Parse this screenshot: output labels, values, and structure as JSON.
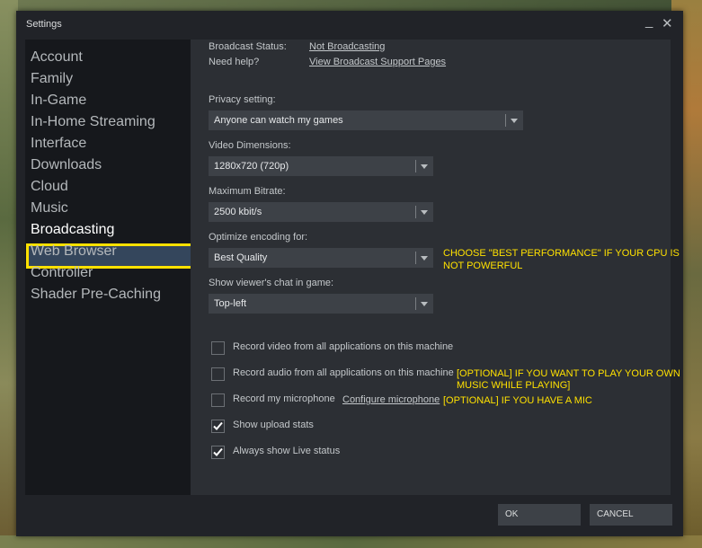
{
  "window": {
    "title": "Settings",
    "minimize_glyph": "_",
    "close_glyph": "✕"
  },
  "sidebar": {
    "items": [
      {
        "label": "Account"
      },
      {
        "label": "Family"
      },
      {
        "label": "In-Game"
      },
      {
        "label": "In-Home Streaming"
      },
      {
        "label": "Interface"
      },
      {
        "label": "Downloads"
      },
      {
        "label": "Cloud"
      },
      {
        "label": "Music"
      },
      {
        "label": "Broadcasting",
        "active": true
      },
      {
        "label": "Web Browser"
      },
      {
        "label": "Controller"
      },
      {
        "label": "Shader Pre-Caching"
      }
    ]
  },
  "broadcast": {
    "status_label": "Broadcast Status:",
    "status_value": "Not Broadcasting",
    "help_label": "Need help?",
    "help_link": "View Broadcast Support Pages",
    "privacy_label": "Privacy setting:",
    "privacy_value": "Anyone can watch my games",
    "dimensions_label": "Video Dimensions:",
    "dimensions_value": "1280x720 (720p)",
    "bitrate_label": "Maximum Bitrate:",
    "bitrate_value": "2500 kbit/s",
    "encoding_label": "Optimize encoding for:",
    "encoding_value": "Best Quality",
    "chat_label": "Show viewer's chat in game:",
    "chat_value": "Top-left",
    "record_video": {
      "label": "Record video from all applications on this machine",
      "checked": false
    },
    "record_audio": {
      "label": "Record audio from all applications on this machine",
      "checked": false
    },
    "record_mic": {
      "label": "Record my microphone",
      "checked": false,
      "configure_link": "Configure microphone"
    },
    "upload_stats": {
      "label": "Show upload stats",
      "checked": true
    },
    "live_status": {
      "label": "Always show Live status",
      "checked": true
    }
  },
  "annotations": {
    "encoding_note_line1": "CHOOSE \"BEST PERFORMANCE\" IF YOUR CPU IS",
    "encoding_note_line2": "NOT POWERFUL",
    "audio_note_line1": "[OPTIONAL] IF YOU WANT TO PLAY YOUR OWN",
    "audio_note_line2": "MUSIC WHILE PLAYING]",
    "mic_note": "[OPTIONAL] IF YOU HAVE A MIC",
    "color": "#ffe100"
  },
  "footer": {
    "ok_label": "OK",
    "cancel_label": "CANCEL"
  },
  "icons": {
    "dropdown": "chevron-down-icon",
    "checkbox_checked": "checkmark-icon"
  },
  "colors": {
    "accent_highlight": "#ffe100",
    "active_nav_bg": "#34465c",
    "window_bg": "#212328"
  }
}
